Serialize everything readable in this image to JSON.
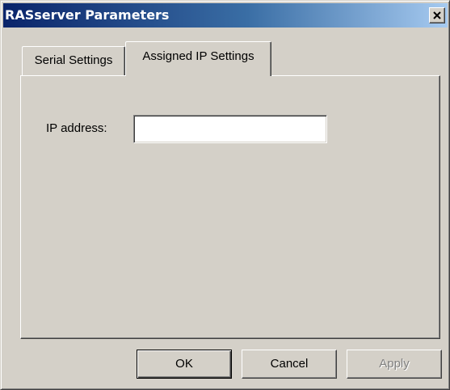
{
  "window": {
    "title": "RASserver Parameters",
    "close_icon": "close-icon"
  },
  "tabs": [
    {
      "label": "Serial Settings",
      "active": false
    },
    {
      "label": "Assigned IP Settings",
      "active": true
    }
  ],
  "form": {
    "ip_address_label": "IP address:",
    "ip_address_value": "",
    "ip_address_placeholder": ""
  },
  "buttons": {
    "ok_label": "OK",
    "cancel_label": "Cancel",
    "apply_label": "Apply",
    "apply_enabled": false
  },
  "colors": {
    "face": "#d4d0c8",
    "title_start": "#0a246a",
    "title_end": "#a6caf0"
  }
}
